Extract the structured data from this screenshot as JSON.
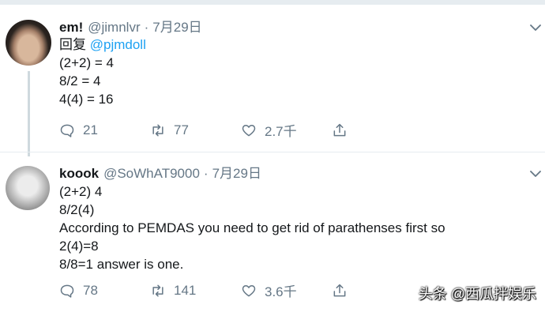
{
  "tweets": [
    {
      "display_name": "em!",
      "handle": "@jimnlvr",
      "separator": "·",
      "date": "7月29日",
      "reply_prefix": "回复",
      "reply_mention": "@pjmdoll",
      "lines": [
        "(2+2) = 4",
        "8/2 = 4",
        "4(4) = 16"
      ],
      "replies": "21",
      "retweets": "77",
      "likes": "2.7千"
    },
    {
      "display_name": "koook",
      "handle": "@SoWhAT9000",
      "separator": "·",
      "date": "7月29日",
      "lines": [
        "(2+2) 4",
        "8/2(4)",
        "According to PEMDAS you need to get rid of parathenses first so",
        "2(4)=8",
        "8/8=1 answer is one."
      ],
      "replies": "78",
      "retweets": "141",
      "likes": "3.6千"
    }
  ],
  "watermark": "头条 @西瓜拌娱乐",
  "icons": {
    "reply": "reply-icon",
    "retweet": "retweet-icon",
    "like": "heart-icon",
    "share": "share-icon",
    "menu": "chevron-down-icon"
  },
  "colors": {
    "text": "#14171a",
    "muted": "#657786",
    "link": "#1da1f2",
    "divider": "#e6ecf0"
  }
}
